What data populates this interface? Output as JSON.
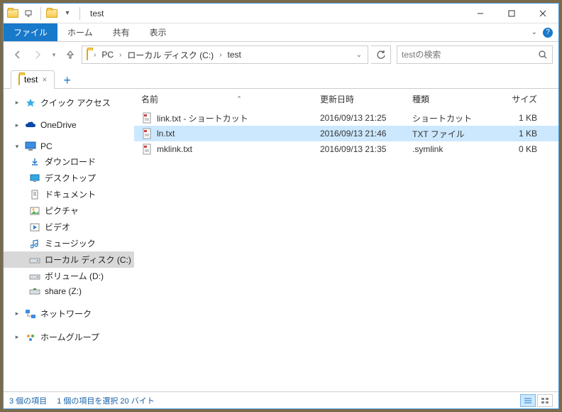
{
  "window": {
    "title": "test"
  },
  "ribbon": {
    "file": "ファイル",
    "home": "ホーム",
    "share": "共有",
    "view": "表示"
  },
  "breadcrumb": {
    "segments": [
      "PC",
      "ローカル ディスク (C:)",
      "test"
    ]
  },
  "search": {
    "placeholder": "testの検索"
  },
  "tab": {
    "label": "test"
  },
  "sidebar": {
    "quick_access": "クイック アクセス",
    "onedrive": "OneDrive",
    "pc": "PC",
    "downloads": "ダウンロード",
    "desktop": "デスクトップ",
    "documents": "ドキュメント",
    "pictures": "ピクチャ",
    "videos": "ビデオ",
    "music": "ミュージック",
    "local_disk": "ローカル ディスク (C:)",
    "volume_d": "ボリューム (D:)",
    "share_z": "share (Z:)",
    "network": "ネットワーク",
    "homegroup": "ホームグループ"
  },
  "columns": {
    "name": "名前",
    "date": "更新日時",
    "type": "種類",
    "size": "サイズ"
  },
  "files": [
    {
      "name": "link.txt - ショートカット",
      "date": "2016/09/13 21:25",
      "type": "ショートカット",
      "size": "1 KB",
      "selected": false
    },
    {
      "name": "ln.txt",
      "date": "2016/09/13 21:46",
      "type": "TXT ファイル",
      "size": "1 KB",
      "selected": true
    },
    {
      "name": "mklink.txt",
      "date": "2016/09/13 21:35",
      "type": ".symlink",
      "size": "0 KB",
      "selected": false
    }
  ],
  "status": {
    "count": "3 個の項目",
    "selection": "1 個の項目を選択 20 バイト"
  }
}
